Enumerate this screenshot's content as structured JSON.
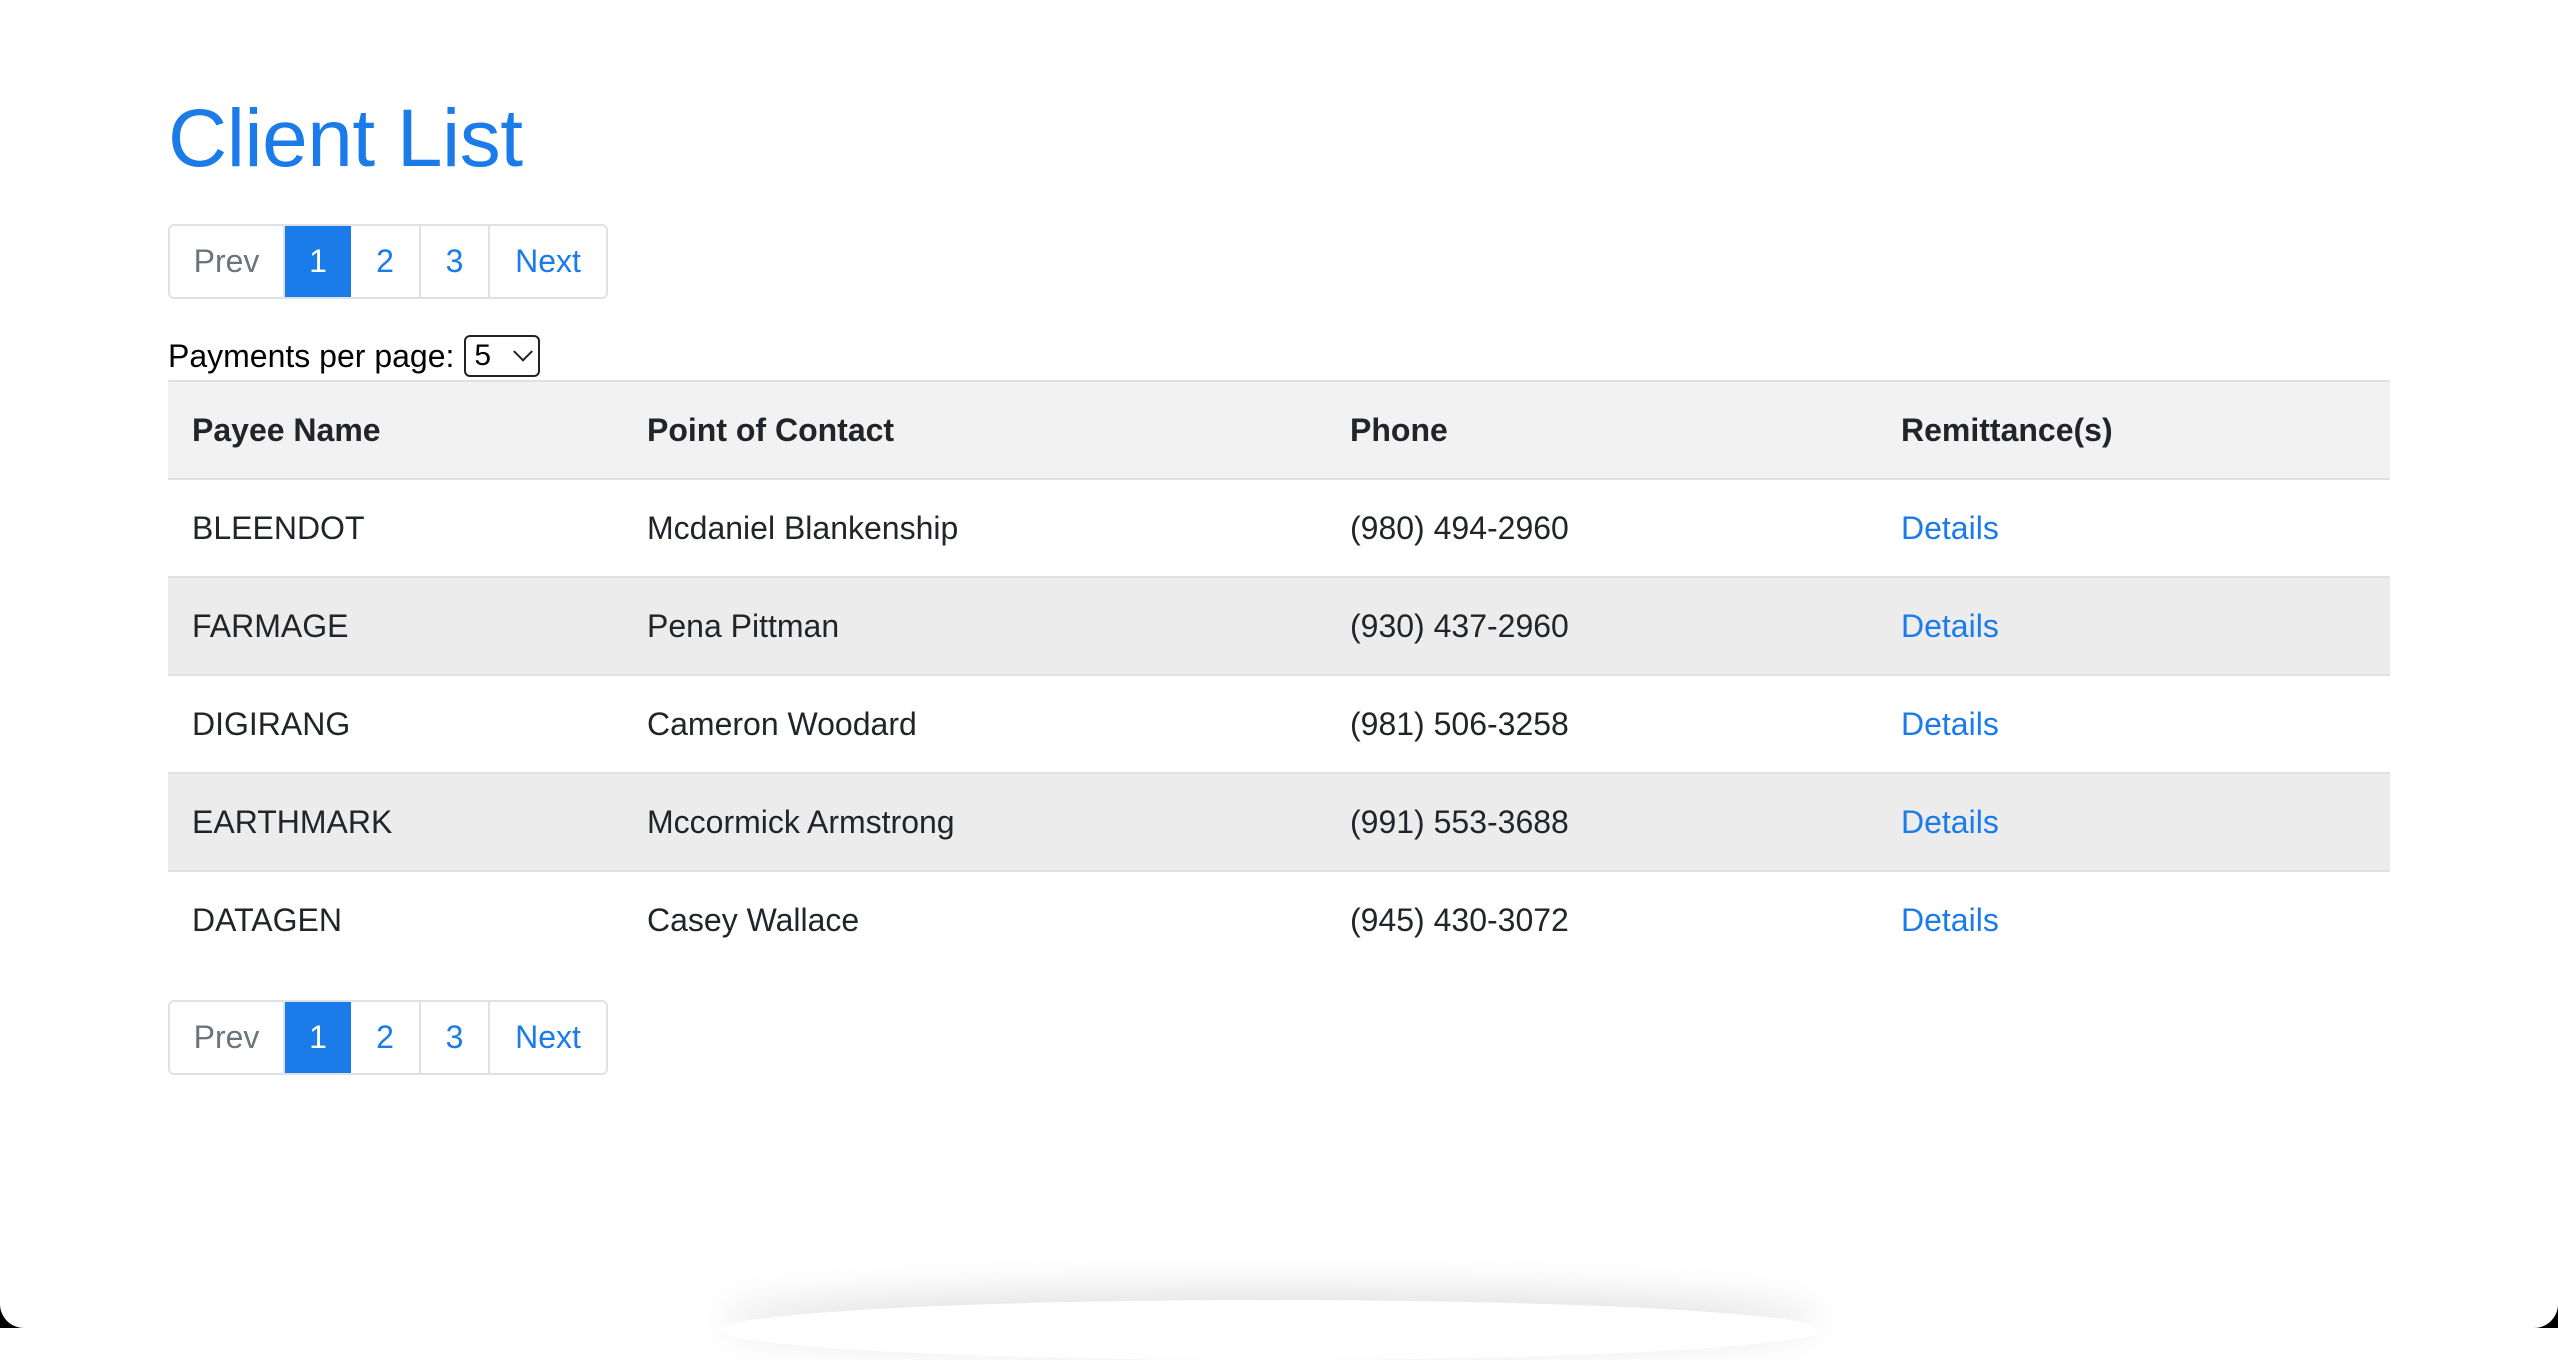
{
  "page": {
    "title": "Client List"
  },
  "pagination": {
    "prev": "Prev",
    "pages": [
      "1",
      "2",
      "3"
    ],
    "current": "1",
    "next": "Next"
  },
  "per_page": {
    "label": "Payments per page:",
    "selected": "5"
  },
  "table": {
    "headers": [
      "Payee Name",
      "Point of Contact",
      "Phone",
      "Remittance(s)"
    ],
    "rows": [
      {
        "payee": "BLEENDOT",
        "contact": "Mcdaniel Blankenship",
        "phone": "(980) 494-2960",
        "link": "Details"
      },
      {
        "payee": "FARMAGE",
        "contact": "Pena Pittman",
        "phone": "(930) 437-2960",
        "link": "Details"
      },
      {
        "payee": "DIGIRANG",
        "contact": "Cameron Woodard",
        "phone": "(981) 506-3258",
        "link": "Details"
      },
      {
        "payee": "EARTHMARK",
        "contact": "Mccormick Armstrong",
        "phone": "(991) 553-3688",
        "link": "Details"
      },
      {
        "payee": "DATAGEN",
        "contact": "Casey Wallace",
        "phone": "(945) 430-3072",
        "link": "Details"
      }
    ]
  },
  "colors": {
    "accent": "#1b7be8",
    "header_bg": "#f2f2f2",
    "alt_row_bg": "#ececec",
    "border": "#dee2e6"
  }
}
